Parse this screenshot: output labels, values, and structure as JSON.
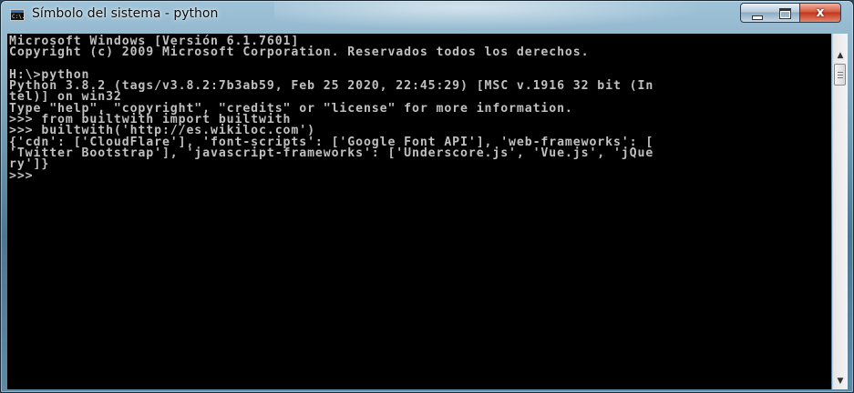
{
  "window": {
    "title": "Símbolo del sistema - python",
    "icon_name": "cmd-icon",
    "icon_text": "C:\\."
  },
  "controls": {
    "minimize": "minimize-icon",
    "maximize": "maximize-icon",
    "close_glyph": "x"
  },
  "console": {
    "lines": [
      "Microsoft Windows [Versión 6.1.7601]",
      "Copyright (c) 2009 Microsoft Corporation. Reservados todos los derechos.",
      "",
      "H:\\>python",
      "Python 3.8.2 (tags/v3.8.2:7b3ab59, Feb 25 2020, 22:45:29) [MSC v.1916 32 bit (In",
      "tel)] on win32",
      "Type \"help\", \"copyright\", \"credits\" or \"license\" for more information.",
      ">>> from builtwith import builtwith",
      ">>> builtwith('http://es.wikiloc.com')",
      "{'cdn': ['CloudFlare'], 'font-scripts': ['Google Font API'], 'web-frameworks': [",
      "'Twitter Bootstrap'], 'javascript-frameworks': ['Underscore.js', 'Vue.js', 'jQue",
      "ry']}",
      ">>>"
    ]
  },
  "scrollbar": {
    "up_glyph": "▲",
    "down_glyph": "▼"
  }
}
